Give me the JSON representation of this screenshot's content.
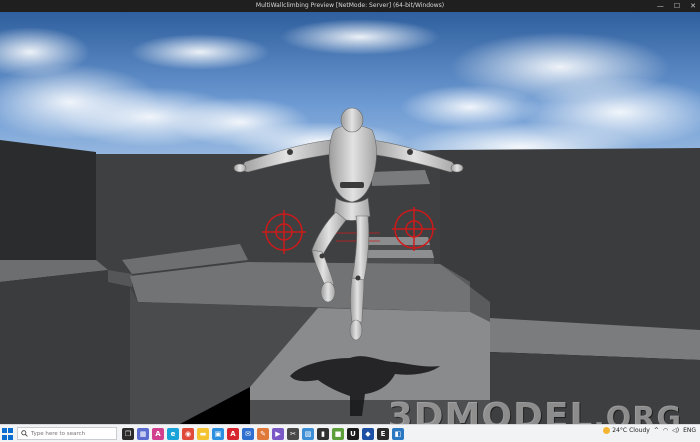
{
  "window": {
    "title": "MultiWallclimbing Preview [NetMode: Server]  (64-bit/Windows)"
  },
  "watermark": {
    "text": "3DMODEL",
    "suffix": ".ORG"
  },
  "taskbar": {
    "search_placeholder": "Type here to search",
    "apps": [
      {
        "name": "task-view-icon",
        "color": "#2b2b2b",
        "glyph": "❐"
      },
      {
        "name": "calendar-app-icon",
        "color": "#5b6cd1",
        "glyph": "▦"
      },
      {
        "name": "adobe-app-icon",
        "color": "#d13f8f",
        "glyph": "A"
      },
      {
        "name": "edge-browser-icon",
        "color": "#1aa3d8",
        "glyph": "e"
      },
      {
        "name": "chrome-browser-icon",
        "color": "#e04a3a",
        "glyph": "◉"
      },
      {
        "name": "file-explorer-icon",
        "color": "#f4c430",
        "glyph": "▬"
      },
      {
        "name": "store-app-icon",
        "color": "#2d8fe0",
        "glyph": "▣"
      },
      {
        "name": "pdf-reader-icon",
        "color": "#d8262e",
        "glyph": "A"
      },
      {
        "name": "mail-app-icon",
        "color": "#2f6fd0",
        "glyph": "✉"
      },
      {
        "name": "paint-app-icon",
        "color": "#e0783a",
        "glyph": "✎"
      },
      {
        "name": "media-player-icon",
        "color": "#7a58c6",
        "glyph": "▶"
      },
      {
        "name": "tools-app-icon",
        "color": "#4a4a4a",
        "glyph": "✂"
      },
      {
        "name": "photos-app-icon",
        "color": "#3c8fd6",
        "glyph": "▧"
      },
      {
        "name": "terminal-app-icon",
        "color": "#323232",
        "glyph": "▮"
      },
      {
        "name": "minecraft-app-icon",
        "color": "#5c9e3a",
        "glyph": "■"
      },
      {
        "name": "unreal-engine-icon",
        "color": "#1a1a1a",
        "glyph": "U"
      },
      {
        "name": "game-launcher-icon",
        "color": "#1d4fa5",
        "glyph": "◆"
      },
      {
        "name": "epic-games-icon",
        "color": "#2a2a2a",
        "glyph": "E"
      },
      {
        "name": "code-editor-icon",
        "color": "#2b78c2",
        "glyph": "◧"
      }
    ],
    "tray": {
      "temperature": "24°C",
      "weather": "Cloudy",
      "language": "ENG"
    }
  }
}
